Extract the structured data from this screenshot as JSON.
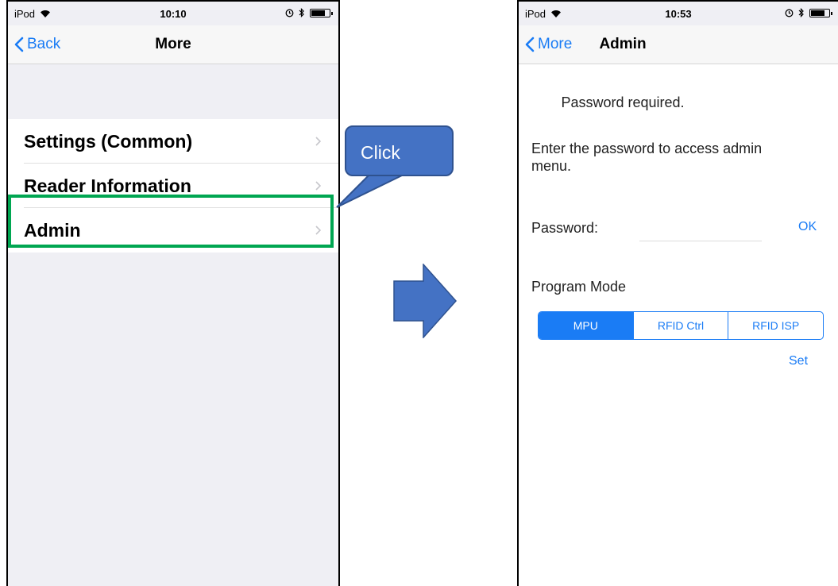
{
  "left_screen": {
    "status": {
      "carrier": "iPod",
      "time": "10:10"
    },
    "nav": {
      "back_label": "Back",
      "title": "More"
    },
    "items": [
      {
        "label": "Settings (Common)"
      },
      {
        "label": "Reader Information"
      },
      {
        "label": "Admin"
      }
    ]
  },
  "annotation": {
    "callout_text": "Click",
    "callout_color": "#4472c4",
    "highlight_color": "#00a651",
    "arrow_color": "#4472c4"
  },
  "right_screen": {
    "status": {
      "carrier": "iPod",
      "time": "10:53"
    },
    "nav": {
      "back_label": "More",
      "title": "Admin"
    },
    "password_heading": "Password required.",
    "password_description": "Enter the password to access admin menu.",
    "password_label": "Password:",
    "password_value": "",
    "ok_label": "OK",
    "program_mode_label": "Program Mode",
    "mode_options": [
      "MPU",
      "RFID Ctrl",
      "RFID ISP"
    ],
    "selected_mode": "MPU",
    "set_label": "Set"
  },
  "colors": {
    "accent": "#1a7cf5",
    "background": "#efeff4"
  },
  "icons": [
    "wifi-icon",
    "alarm-icon",
    "bluetooth-icon",
    "battery-icon",
    "chevron-left-icon",
    "chevron-right-icon",
    "arrow-right-icon"
  ]
}
